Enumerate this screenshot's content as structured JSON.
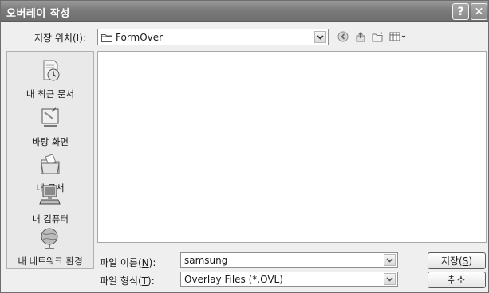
{
  "dialog": {
    "title": "오버레이 작성",
    "help_glyph": "?",
    "close_glyph": "✕"
  },
  "save_in": {
    "label": "저장 위치(I):",
    "folder": "FormOver"
  },
  "places": [
    {
      "label": "내 최근 문서",
      "icon": "recent-documents-icon"
    },
    {
      "label": "바탕 화면",
      "icon": "desktop-icon"
    },
    {
      "label": "내 문서",
      "icon": "my-documents-icon"
    },
    {
      "label": "내 컴퓨터",
      "icon": "my-computer-icon"
    },
    {
      "label": "내 네트워크 환경",
      "icon": "network-places-icon"
    }
  ],
  "file_name": {
    "label_prefix": "파일 이름(",
    "label_key": "N",
    "label_suffix": "):",
    "value": "samsung"
  },
  "file_type": {
    "label_prefix": "파일 형식(",
    "label_key": "T",
    "label_suffix": "):",
    "value": "Overlay Files (*.OVL)"
  },
  "buttons": {
    "save_prefix": "저장(",
    "save_key": "S",
    "save_suffix": ")",
    "cancel": "취소"
  },
  "colors": {
    "title_bar": "#7a7a7a",
    "dialog_bg": "#efefef",
    "list_bg": "#ffffff"
  }
}
